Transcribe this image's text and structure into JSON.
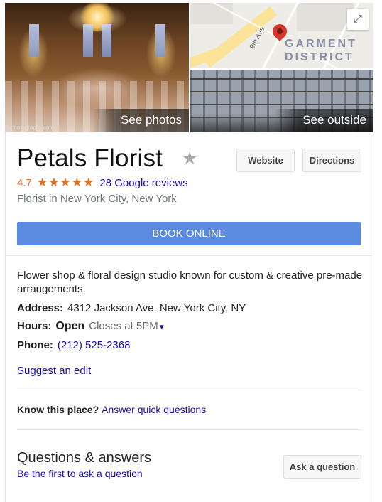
{
  "photos": {
    "main_label": "See photos",
    "credit": "lxphotography.com",
    "outside_label": "See outside"
  },
  "map": {
    "district_line1": "GARMENT",
    "district_line2": "DISTRICT",
    "street_label": "9th Ave",
    "expand_icon": "expand-icon"
  },
  "business": {
    "name": "Petals Florist",
    "rating": "4.7",
    "stars": "★★★★★",
    "reviews": "28 Google reviews",
    "category": "Florist in New York City, New York",
    "website_label": "Website",
    "directions_label": "Directions",
    "book_label": "BOOK ONLINE"
  },
  "details": {
    "description": "Flower shop & floral design studio known for custom & creative pre-made arrangements.",
    "address_label": "Address:",
    "address": "4312 Jackson Ave. New York City, NY",
    "hours_label": "Hours:",
    "hours_status": "Open",
    "hours_detail": "Closes at 5PM",
    "phone_label": "Phone:",
    "phone": "(212) 525-2368",
    "suggest_edit": "Suggest an edit"
  },
  "know": {
    "label": "Know this place?",
    "link": "Answer quick questions"
  },
  "qa": {
    "title": "Questions & answers",
    "link": "Be the first to ask a question",
    "ask_button": "Ask a question"
  },
  "colors": {
    "accent_blue": "#5b8be0",
    "link": "#1a0dab",
    "star": "#e7711b",
    "pin": "#d3362b"
  }
}
